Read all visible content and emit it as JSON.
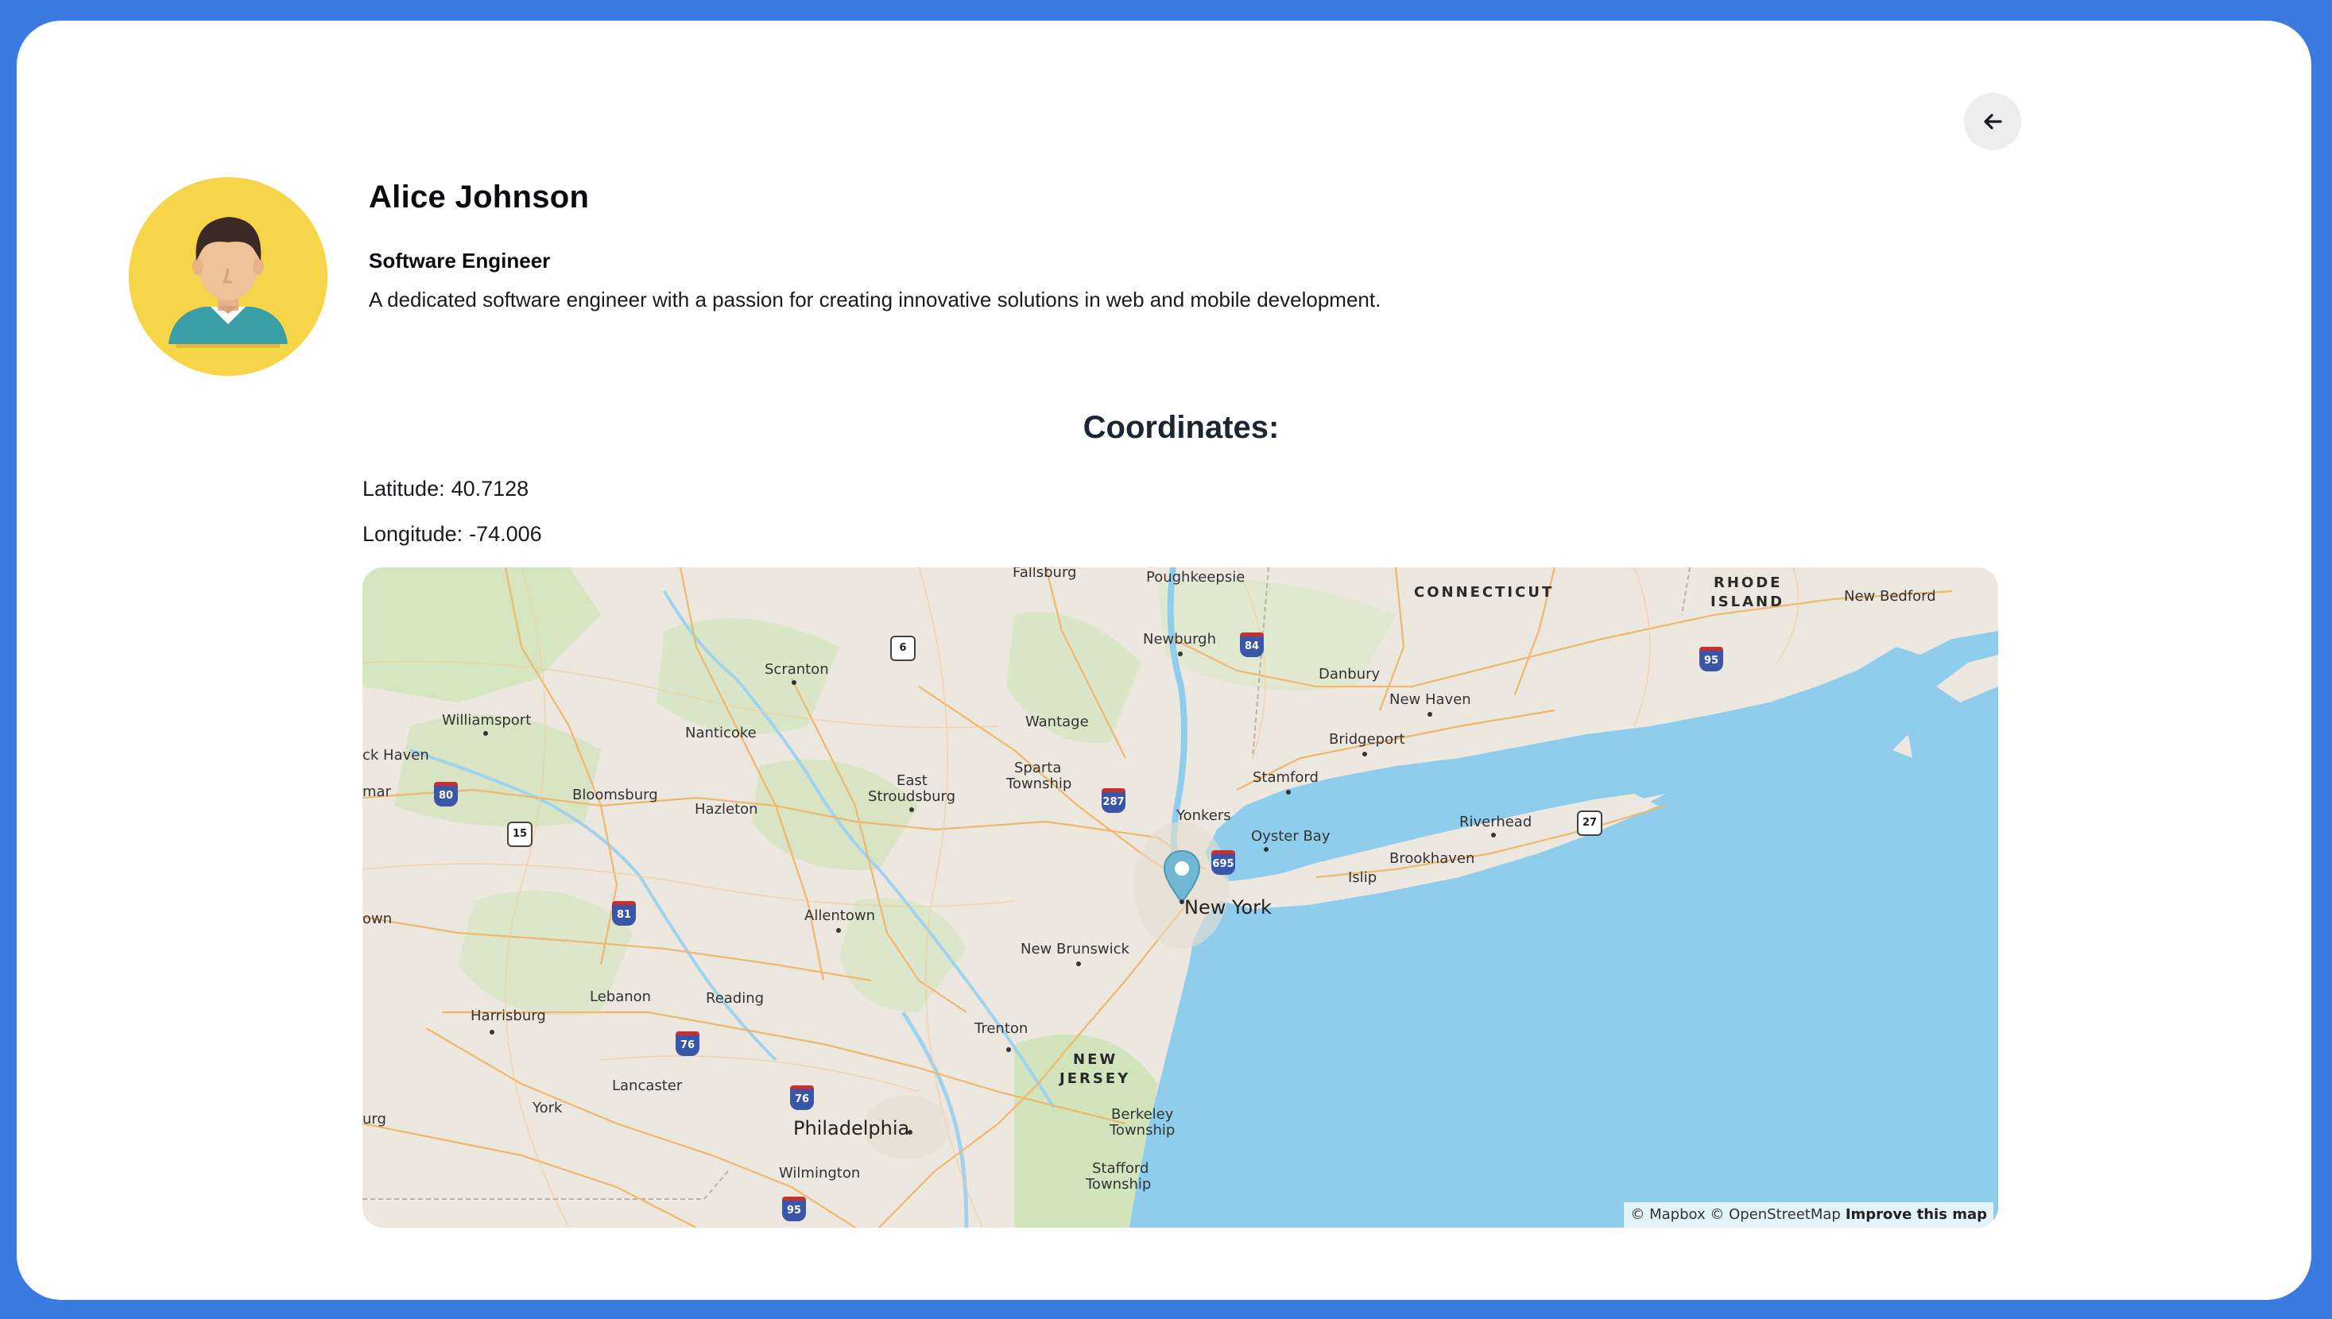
{
  "profile": {
    "name": "Alice Johnson",
    "role": "Software Engineer",
    "bio": "A dedicated software engineer with a passion for creating innovative solutions in web and mobile development.",
    "avatar_icon": "person-avatar-icon"
  },
  "header": {
    "back_icon": "arrow-left-icon"
  },
  "coordinates": {
    "title": "Coordinates:",
    "latitude_label": "Latitude:",
    "latitude": "40.7128",
    "longitude_label": "Longitude:",
    "longitude": "-74.006"
  },
  "map": {
    "pin_label": "New York",
    "attribution": "© Mapbox © OpenStreetMap",
    "improve_link": "Improve this map",
    "states": [
      "CONNECTICUT",
      "RHODE",
      "ISLAND",
      "NEW",
      "JERSEY"
    ],
    "cities": [
      "Fallsburg",
      "Poughkeepsie",
      "Newburgh",
      "Danbury",
      "Scranton",
      "Williamsport",
      "Nanticoke",
      "Wantage",
      "Sparta",
      "Township",
      "East",
      "Stroudsburg",
      "Bloomsburg",
      "Hazleton",
      "New Haven",
      "Bridgeport",
      "Stamford",
      "Yonkers",
      "Oyster Bay",
      "Riverhead",
      "Islip",
      "Brookhaven",
      "Allentown",
      "New Brunswick",
      "Harrisburg",
      "Lebanon",
      "Reading",
      "Trenton",
      "Lancaster",
      "York",
      "Philadelphia",
      "Wilmington",
      "Berkeley",
      "Township",
      "Stafford",
      "Township",
      "New Bedford",
      "ck Haven",
      "mar",
      "own",
      "urg"
    ],
    "shields": [
      "6",
      "84",
      "95",
      "80",
      "15",
      "287",
      "695",
      "27",
      "81",
      "76",
      "76",
      "95"
    ],
    "colors": {
      "water": "#8ecdec",
      "land": "#ece7df",
      "green": "#cfe3b8",
      "roads": "#f2b569",
      "accent": "#3b7be0"
    }
  }
}
